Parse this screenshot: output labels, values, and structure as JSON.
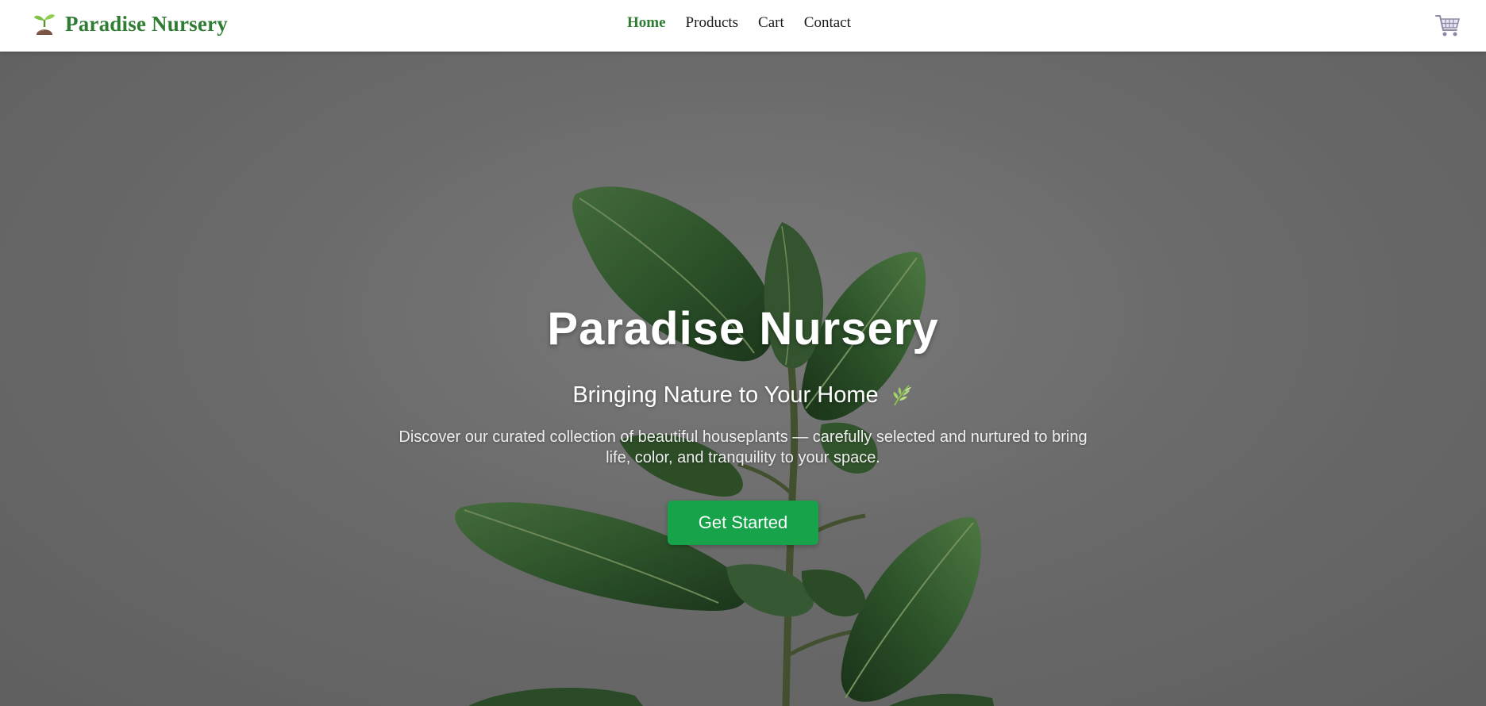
{
  "navbar": {
    "brand": "Paradise Nursery",
    "links": [
      {
        "label": "Home",
        "active": true
      },
      {
        "label": "Products",
        "active": false
      },
      {
        "label": "Cart",
        "active": false
      },
      {
        "label": "Contact",
        "active": false
      }
    ],
    "cart_icon": "shopping-cart-icon"
  },
  "hero": {
    "title": "Paradise Nursery",
    "subtitle": "Bringing Nature to Your Home",
    "subtitle_icon": "leaf-sprig-icon",
    "description": "Discover our curated collection of beautiful houseplants — carefully selected and nurtured to bring life, color, and tranquility to your space.",
    "button_label": "Get Started"
  },
  "colors": {
    "brand_green": "#2e7d32",
    "button_green": "#16a34a",
    "navbar_bg": "#ffffff",
    "hero_bg": "#7a7a7a"
  }
}
